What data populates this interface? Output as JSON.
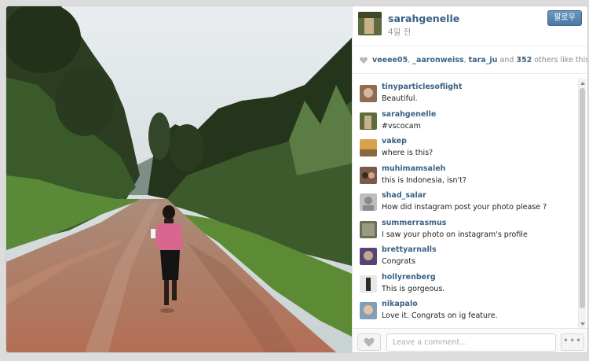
{
  "post": {
    "owner": "sarahgenelle",
    "age": "4일 전",
    "follow_label": "팔로우",
    "photo_alt": "child walking on a red dirt road between banana trees"
  },
  "likes": {
    "names": [
      "veeee05",
      "_aaronweiss",
      "tara_ju"
    ],
    "sep": ", ",
    "and": " and ",
    "count": "352",
    "suffix": " others like this."
  },
  "comments": [
    {
      "user": "tinyparticlesoflight",
      "text": "Beautiful."
    },
    {
      "user": "sarahgenelle",
      "text": "#vscocam"
    },
    {
      "user": "vakep",
      "text": "where is this?"
    },
    {
      "user": "muhimamsaleh",
      "text": "this is Indonesia, isn't?"
    },
    {
      "user": "shad_salar",
      "text": "How did instagram post your photo please ?"
    },
    {
      "user": "summerrasmus",
      "text": "I saw your photo on instagram's profile"
    },
    {
      "user": "brettyarnalls",
      "text": "Congrats"
    },
    {
      "user": "hollyrenberg",
      "text": "This is gorgeous."
    },
    {
      "user": "nikapalo",
      "text": "Love it. Congrats on ig feature."
    }
  ],
  "footer": {
    "comment_placeholder": "Leave a comment...",
    "more_label": "•••"
  },
  "colors": {
    "accent": "#3a6186",
    "follow_button": "#5884b0"
  },
  "icons": {
    "like": "heart-icon",
    "more": "more-options-icon"
  }
}
